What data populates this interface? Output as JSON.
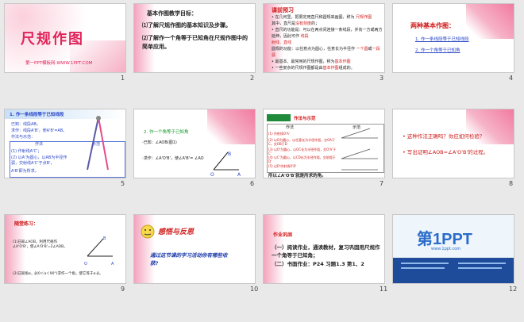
{
  "slides": [
    {
      "num": "1",
      "title": "尺规作图",
      "footer": "第一PPT模板网-WWW.1PPT.COM"
    },
    {
      "num": "2",
      "heading": "基本作图教学目标：",
      "line1": "⑴了解尺规作图的基本知识及步骤。",
      "line2": "⑵了解作一个角等于已知角在尺规作图中的简单应用。"
    },
    {
      "num": "3",
      "heading": "课前预习",
      "l1": "• 在几何里，把限定用直尺和圆规来画图，称为",
      "l1r": "尺规作图",
      "l2": "其中，直尺是",
      "l2r": "没有刻度",
      "l2b": "的；",
      "l3": "• 直尺的功能是：可以在两点间连接一条线段，并向一方或两方延伸，因此可作",
      "l3r": "线段",
      "l4": "射线、直线",
      "l5": "圆规的功能：以任意点为圆心，任意长为半径作",
      "l5r": "一个圆",
      "l5b": "或",
      "l5c": "一段弧",
      "l6": "• 最基本、最常用的尺规作图，称为",
      "l6r": "基本作图",
      "l7": "• 一些复杂的尺规作图都是由",
      "l7r": "基本作图",
      "l7b": "组成的。"
    },
    {
      "num": "4",
      "heading": "两种基本作图：",
      "i1": "1. 作一条线段等于已知线段",
      "i2": "2. 作一个角等于已知角"
    },
    {
      "num": "5",
      "heading": "1. 作一条线段等于已知线段",
      "g1": "已知：线段AB。",
      "g2": "求作：线段A'B'，使A'B'=AB。",
      "g3": "作法与示范：",
      "h1": "作法",
      "h2": "示范",
      "s1": "(1) 作射线A'C'；",
      "s2": "(2) 以A'为圆心，以AB为半径作弧，交射线A'C'于点B'，",
      "s3": "A'B'即为所求。"
    },
    {
      "num": "6",
      "heading": "2. 作一个角等于已知角",
      "g1": "·已知：∠AOB(图1)",
      "g2": "·求作：∠A'O'B'，使∠A'B'= ∠AO",
      "o": "O",
      "a": "A",
      "b": "B"
    },
    {
      "num": "7",
      "tab": "作法与示范",
      "h1": "作法",
      "h2": "示范",
      "r1": "(1) 作射线O'A'",
      "r2": "(2) 以O为圆心，以任意长为半径作弧，交OA于C，交OB于D",
      "r3": "(3) 以O'为圆心，以OC长为半径作弧，交O'A'于C'",
      "r4": "(4) 以C'为圆心，以CD长为半径作弧，交前弧于D'",
      "r5": "(5) 过D'作射线O'B'",
      "footer": "所以∠A'O'B'就是所求的角。"
    },
    {
      "num": "8",
      "q1": "这种作法正确吗？你应如何检验？",
      "q2": "写出证明∠AOB=∠A'O'B'的过程。"
    },
    {
      "num": "9",
      "heading": "随堂练习：",
      "l1": "(1)已知∠AOB，利用尺规作∠A'O'B'，使∠A'O'B'=2∠AOB。",
      "l2": "(2)已知角α，β(0＜α＜90°)求作一个角，使它等于α-β。",
      "o": "O",
      "a": "A",
      "b": "B"
    },
    {
      "num": "10",
      "heading": "感悟与反思",
      "text": "通过这节课的学习活动你有哪些收获?"
    },
    {
      "num": "11",
      "heading": "作业巩固",
      "l1": "（一）阅读作业，通读教材，复习巩固用尺规作一个角等于已知角；",
      "l2": "（二）书面作业：P24 习题1.3 第1、2"
    },
    {
      "num": "12",
      "brand": "第1PPT",
      "tagline": "www.1ppt.com"
    }
  ]
}
